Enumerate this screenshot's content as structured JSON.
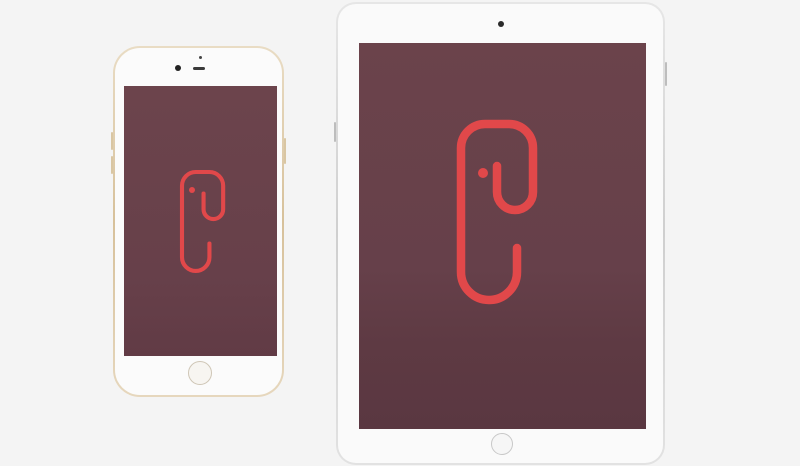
{
  "devices": {
    "phone": {
      "model": "smartphone",
      "finish": "gold"
    },
    "tablet": {
      "model": "tablet",
      "finish": "silver"
    }
  },
  "app_logo": {
    "name": "app-logo-icon",
    "color": "#e1484a"
  },
  "colors": {
    "background": "#f4f4f4",
    "screen": "#6a424a",
    "logo_accent": "#e1484a",
    "phone_frame": "#d7c19b",
    "tablet_frame": "#cfcfcf"
  }
}
